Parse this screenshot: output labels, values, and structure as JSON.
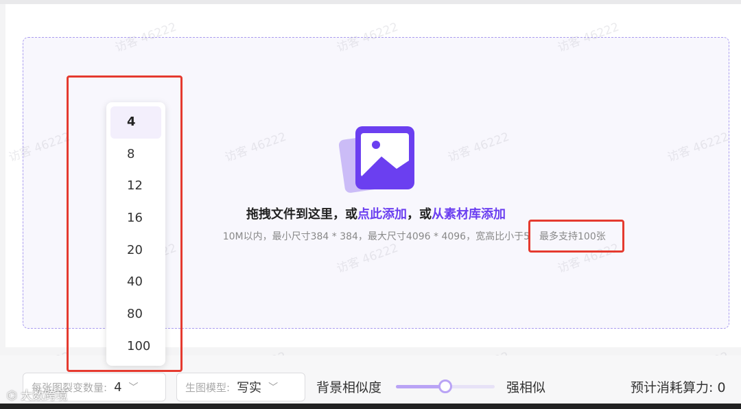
{
  "upload": {
    "title_prefix": "拖拽文件到这里，或",
    "title_link1": "点此添加",
    "title_mid": "，或",
    "title_link2": "从素材库添加",
    "subtitle": "10M以内，最小尺寸384 * 384，最大尺寸4096 * 4096，宽高比小于5",
    "max_note": "最多支持100张"
  },
  "watermark_text": "访客 46222",
  "dropdown": {
    "options": [
      "4",
      "8",
      "12",
      "16",
      "20",
      "40",
      "80",
      "100"
    ],
    "selected": "4"
  },
  "bottom_bar": {
    "count_label": "每张图裂变数量:",
    "count_value": "4",
    "model_label": "生图模型:",
    "model_value": "写实",
    "bg_label": "背景相似度",
    "slider_value_percent": 50,
    "bg_right_label": "强相似",
    "cost_label": "预计消耗算力: 0"
  },
  "source_mark": "大数跨境",
  "colors": {
    "accent": "#6b3ff0",
    "highlight_box": "#e53a2f"
  }
}
